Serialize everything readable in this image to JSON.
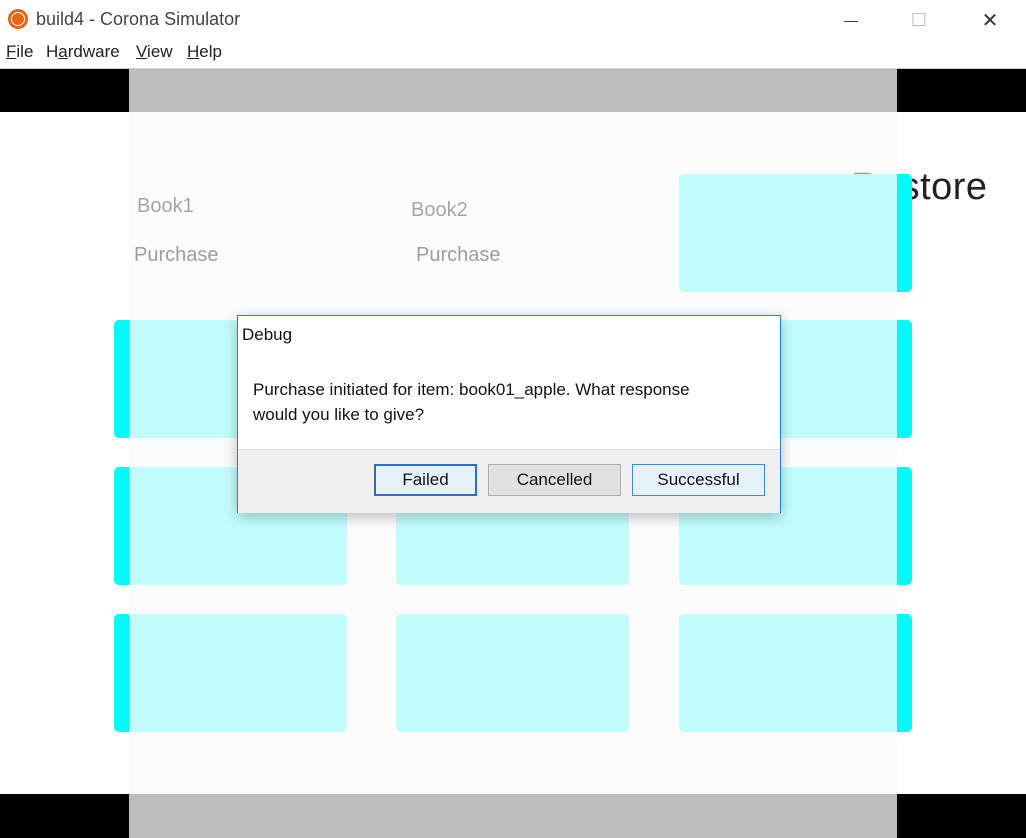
{
  "window": {
    "title": "build4 - Corona Simulator",
    "minimize_glyph": "—",
    "maximize_glyph": "☐",
    "close_glyph": "✕"
  },
  "menu": {
    "items": [
      {
        "underlined": "F",
        "rest": "ile"
      },
      {
        "prefix": "H",
        "underlined": "a",
        "rest": "rdware"
      },
      {
        "underlined": "V",
        "rest": "iew"
      },
      {
        "underlined": "H",
        "rest": "elp"
      }
    ]
  },
  "app": {
    "restore_prefix": "Re",
    "restore_suffix": "store",
    "books": [
      {
        "title": "Book1",
        "action": "Purchase"
      },
      {
        "title": "Book2",
        "action": "Purchase"
      }
    ]
  },
  "dialog": {
    "title": "Debug",
    "message": "Purchase initiated for item: book01_apple.  What response\nwould you like to give?",
    "buttons": {
      "failed": "Failed",
      "cancelled": "Cancelled",
      "successful": "Successful"
    }
  },
  "colors": {
    "tile_fill": "#c2fdfd",
    "tile_edge": "#00fbfb",
    "dialog_border": "#2a7cd0",
    "app_icon": "#e8641b"
  }
}
